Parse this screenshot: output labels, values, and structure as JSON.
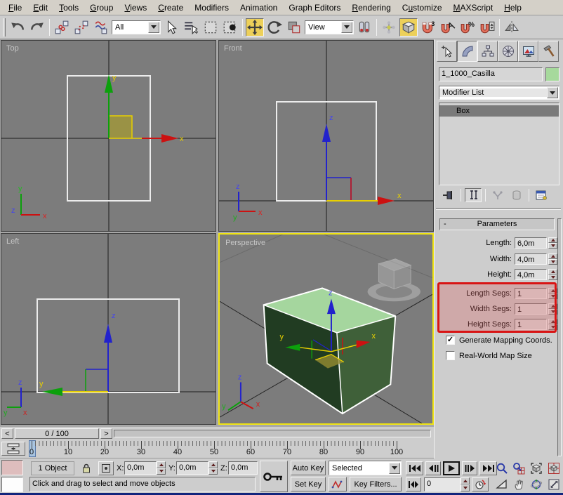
{
  "menu": {
    "items": [
      {
        "label": "File",
        "accel": 0
      },
      {
        "label": "Edit",
        "accel": 0
      },
      {
        "label": "Tools",
        "accel": 0
      },
      {
        "label": "Group",
        "accel": 0
      },
      {
        "label": "Views",
        "accel": 0
      },
      {
        "label": "Create",
        "accel": 0
      },
      {
        "label": "Modifiers",
        "accel": -1
      },
      {
        "label": "Animation",
        "accel": -1
      },
      {
        "label": "Graph Editors",
        "accel": -1
      },
      {
        "label": "Rendering",
        "accel": 0
      },
      {
        "label": "Customize",
        "accel": 1
      },
      {
        "label": "MAXScript",
        "accel": 0
      },
      {
        "label": "Help",
        "accel": 0
      }
    ]
  },
  "toolbar": {
    "selection_filter_value": "All",
    "reference_coordinate_value": "View"
  },
  "viewports": {
    "top_label": "Top",
    "front_label": "Front",
    "left_label": "Left",
    "perspective_label": "Perspective",
    "axis": {
      "x": "x",
      "y": "y",
      "z": "z"
    }
  },
  "time_slider": {
    "prev": "<",
    "value": "0 / 100",
    "next": ">"
  },
  "track_bar": {
    "labels": [
      "0",
      "10",
      "20",
      "30",
      "40",
      "50",
      "60",
      "70",
      "80",
      "90",
      "100"
    ],
    "current_frame": "0"
  },
  "command_panel": {
    "object_name": "1_1000_Casilla",
    "modifier_list_label": "Modifier List",
    "stack_items": [
      {
        "label": "Box",
        "selected": true
      }
    ],
    "parameters": {
      "title": "Parameters",
      "collapse_glyph": "-",
      "dimension_fields": [
        {
          "label": "Length:",
          "value": "6,0m"
        },
        {
          "label": "Width:",
          "value": "4,0m"
        },
        {
          "label": "Height:",
          "value": "4,0m"
        }
      ],
      "segment_fields": [
        {
          "label": "Length Segs:",
          "value": "1"
        },
        {
          "label": "Width Segs:",
          "value": "1"
        },
        {
          "label": "Height Segs:",
          "value": "1"
        }
      ],
      "checkboxes": [
        {
          "label": "Generate Mapping Coords.",
          "checked": true,
          "glyph": "✓"
        },
        {
          "label": "Real-World Map Size",
          "checked": false,
          "glyph": ""
        }
      ]
    }
  },
  "status_bar": {
    "object_count": "1 Object",
    "coords": [
      {
        "label": "X:",
        "value": "0,0m"
      },
      {
        "label": "Y:",
        "value": "0,0m"
      },
      {
        "label": "Z:",
        "value": "0,0m"
      }
    ],
    "prompt": "Click and drag to select and move objects",
    "auto_key_label": "Auto Key",
    "set_key_label": "Set Key",
    "key_filters_label": "Key Filters...",
    "selected_set_value": "Selected",
    "frame_field_value": "0"
  },
  "colors": {
    "active_button_yellow": "#edd05a",
    "active_viewport_border": "#f0e414",
    "annotation_red": "#d81414",
    "object_color_swatch": "#a6d99c",
    "viewport_background": "#7c7c7c",
    "box_top_face": "#a5d69e",
    "box_left_face": "#213c22",
    "box_right_face": "#3f6039",
    "gizmo_x": "#cc1111",
    "gizmo_y": "#0ca00c",
    "gizmo_z": "#2222cc",
    "gizmo_label_yellow": "#e8d000"
  }
}
